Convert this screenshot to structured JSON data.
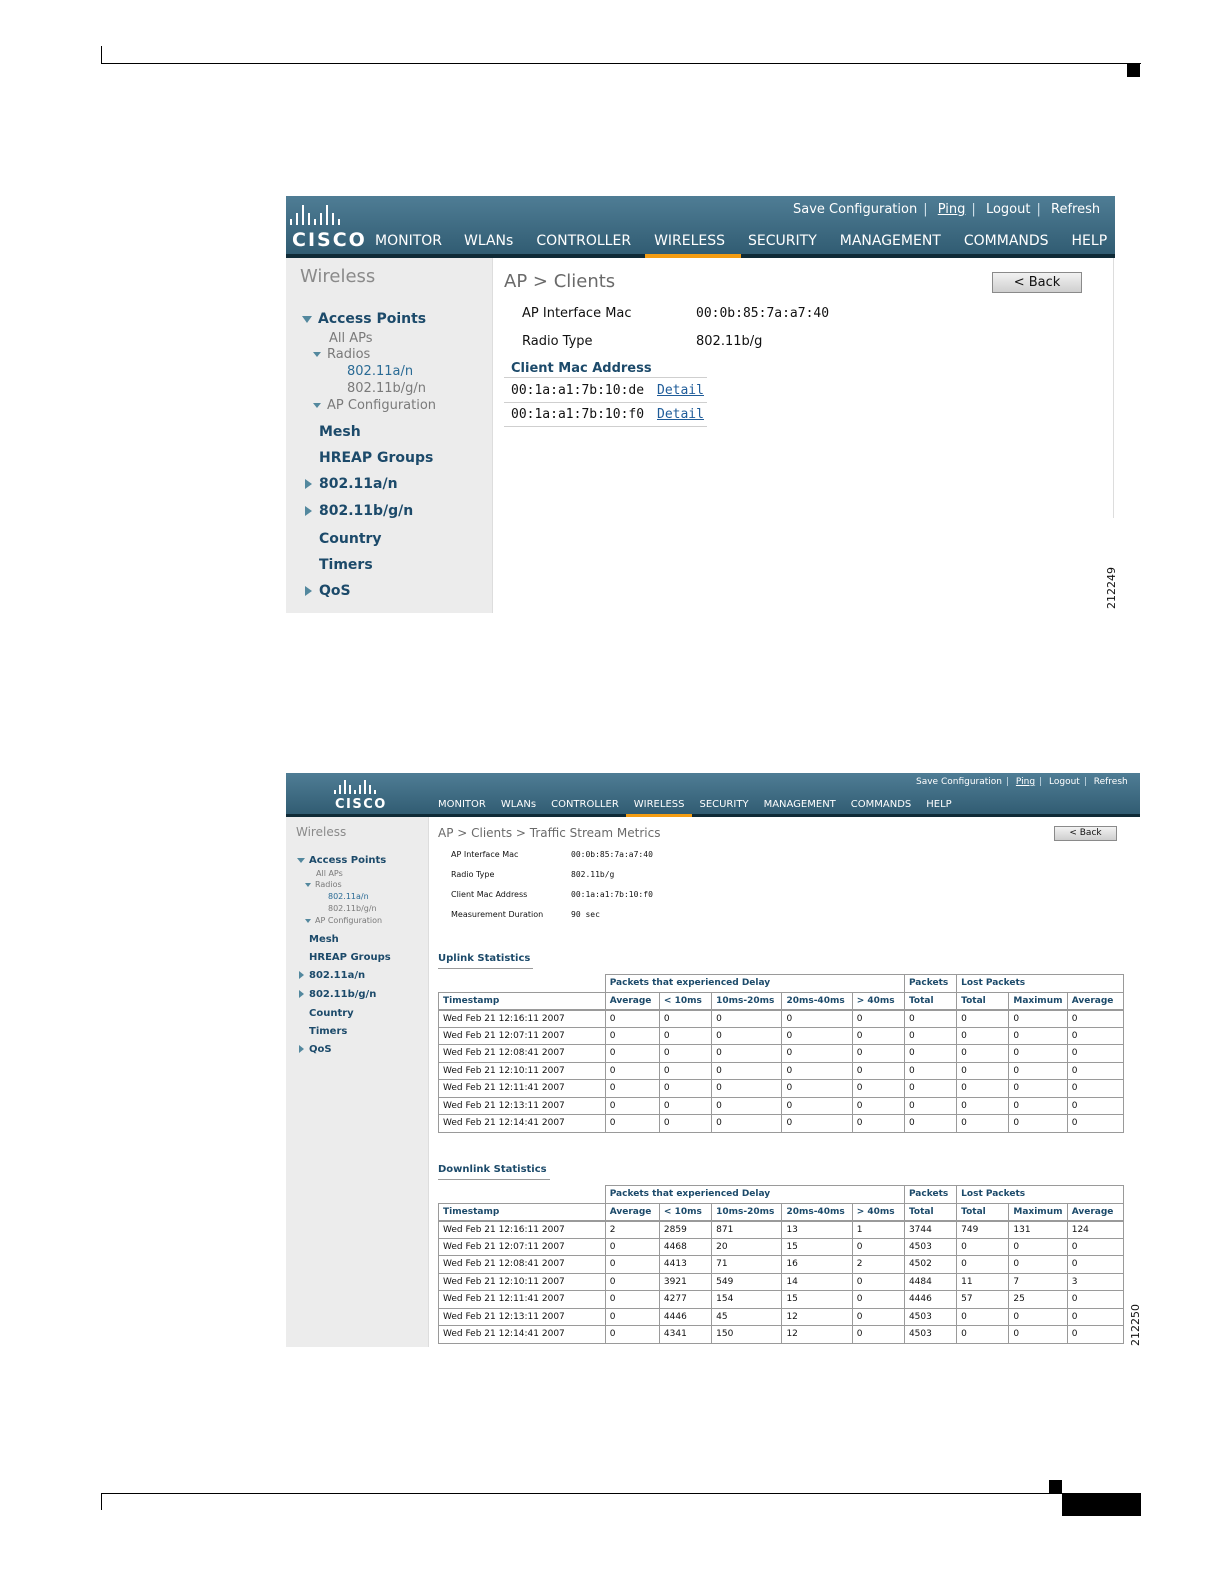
{
  "figure1": {
    "top_links": [
      "Save Configuration",
      "Ping",
      "Logout",
      "Refresh"
    ],
    "logo_text": "CISCO",
    "nav": [
      "MONITOR",
      "WLANs",
      "CONTROLLER",
      "WIRELESS",
      "SECURITY",
      "MANAGEMENT",
      "COMMANDS",
      "HELP"
    ],
    "nav_active": "WIRELESS",
    "sidebar": {
      "title": "Wireless",
      "access_points": "Access Points",
      "all_aps": "All APs",
      "radios": "Radios",
      "radio_a": "802.11a/n",
      "radio_bg": "802.11b/g/n",
      "ap_configuration": "AP Configuration",
      "mesh": "Mesh",
      "hreap_groups": "HREAP Groups",
      "band_a": "802.11a/n",
      "band_bg": "802.11b/g/n",
      "country": "Country",
      "timers": "Timers",
      "qos": "QoS"
    },
    "page_title": "AP > Clients",
    "back_label": "< Back",
    "ap_interface_mac_label": "AP Interface Mac",
    "ap_interface_mac_value": "00:0b:85:7a:a7:40",
    "radio_type_label": "Radio Type",
    "radio_type_value": "802.11b/g",
    "client_mac_header": "Client Mac Address",
    "clients": [
      {
        "mac": "00:1a:a1:7b:10:de",
        "link": "Detail"
      },
      {
        "mac": "00:1a:a1:7b:10:f0",
        "link": "Detail"
      }
    ],
    "figure_id": "212249"
  },
  "figure2": {
    "top_links": [
      "Save Configuration",
      "Ping",
      "Logout",
      "Refresh"
    ],
    "logo_text": "CISCO",
    "nav": [
      "MONITOR",
      "WLANs",
      "CONTROLLER",
      "WIRELESS",
      "SECURITY",
      "MANAGEMENT",
      "COMMANDS",
      "HELP"
    ],
    "nav_active": "WIRELESS",
    "sidebar": {
      "title": "Wireless",
      "access_points": "Access Points",
      "all_aps": "All APs",
      "radios": "Radios",
      "radio_a": "802.11a/n",
      "radio_bg": "802.11b/g/n",
      "ap_configuration": "AP Configuration",
      "mesh": "Mesh",
      "hreap_groups": "HREAP Groups",
      "band_a": "802.11a/n",
      "band_bg": "802.11b/g/n",
      "country": "Country",
      "timers": "Timers",
      "qos": "QoS"
    },
    "page_title": "AP > Clients > Traffic Stream Metrics",
    "back_label": "< Back",
    "info": [
      {
        "label": "AP Interface Mac",
        "value": "00:0b:85:7a:a7:40"
      },
      {
        "label": "Radio Type",
        "value": "802.11b/g"
      },
      {
        "label": "Client Mac Address",
        "value": "00:1a:a1:7b:10:f0"
      },
      {
        "label": "Measurement Duration",
        "value": "90 sec"
      }
    ],
    "group_headers": [
      "Packets that experienced Delay",
      "Packets",
      "Lost Packets"
    ],
    "columns": [
      "Timestamp",
      "Average",
      "< 10ms",
      "10ms-20ms",
      "20ms-40ms",
      "> 40ms",
      "Total",
      "Total",
      "Maximum",
      "Average"
    ],
    "uplink_title": "Uplink Statistics",
    "uplink_rows": [
      [
        "Wed Feb 21 12:16:11 2007",
        "0",
        "0",
        "0",
        "0",
        "0",
        "0",
        "0",
        "0",
        "0"
      ],
      [
        "Wed Feb 21 12:07:11 2007",
        "0",
        "0",
        "0",
        "0",
        "0",
        "0",
        "0",
        "0",
        "0"
      ],
      [
        "Wed Feb 21 12:08:41 2007",
        "0",
        "0",
        "0",
        "0",
        "0",
        "0",
        "0",
        "0",
        "0"
      ],
      [
        "Wed Feb 21 12:10:11 2007",
        "0",
        "0",
        "0",
        "0",
        "0",
        "0",
        "0",
        "0",
        "0"
      ],
      [
        "Wed Feb 21 12:11:41 2007",
        "0",
        "0",
        "0",
        "0",
        "0",
        "0",
        "0",
        "0",
        "0"
      ],
      [
        "Wed Feb 21 12:13:11 2007",
        "0",
        "0",
        "0",
        "0",
        "0",
        "0",
        "0",
        "0",
        "0"
      ],
      [
        "Wed Feb 21 12:14:41 2007",
        "0",
        "0",
        "0",
        "0",
        "0",
        "0",
        "0",
        "0",
        "0"
      ]
    ],
    "downlink_title": "Downlink Statistics",
    "downlink_rows": [
      [
        "Wed Feb 21 12:16:11 2007",
        "2",
        "2859",
        "871",
        "13",
        "1",
        "3744",
        "749",
        "131",
        "124"
      ],
      [
        "Wed Feb 21 12:07:11 2007",
        "0",
        "4468",
        "20",
        "15",
        "0",
        "4503",
        "0",
        "0",
        "0"
      ],
      [
        "Wed Feb 21 12:08:41 2007",
        "0",
        "4413",
        "71",
        "16",
        "2",
        "4502",
        "0",
        "0",
        "0"
      ],
      [
        "Wed Feb 21 12:10:11 2007",
        "0",
        "3921",
        "549",
        "14",
        "0",
        "4484",
        "11",
        "7",
        "3"
      ],
      [
        "Wed Feb 21 12:11:41 2007",
        "0",
        "4277",
        "154",
        "15",
        "0",
        "4446",
        "57",
        "25",
        "0"
      ],
      [
        "Wed Feb 21 12:13:11 2007",
        "0",
        "4446",
        "45",
        "12",
        "0",
        "4503",
        "0",
        "0",
        "0"
      ],
      [
        "Wed Feb 21 12:14:41 2007",
        "0",
        "4341",
        "150",
        "12",
        "0",
        "4503",
        "0",
        "0",
        "0"
      ]
    ],
    "figure_id": "212250"
  }
}
